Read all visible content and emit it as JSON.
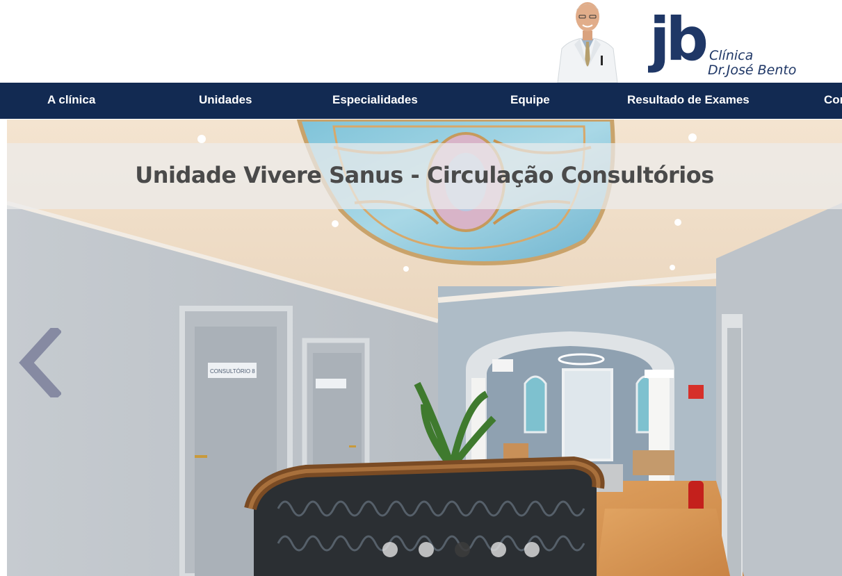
{
  "logo": {
    "mark": "jb",
    "line1": "Clínica",
    "line2": "Dr.José Bento"
  },
  "nav": {
    "items": [
      {
        "label": "A clínica"
      },
      {
        "label": "Unidades"
      },
      {
        "label": "Especialidades"
      },
      {
        "label": "Equipe"
      },
      {
        "label": "Resultado de Exames"
      },
      {
        "label": "Con"
      }
    ]
  },
  "slider": {
    "caption": "Unidade Vivere Sanus - Circulação Consultórios",
    "door_sign": "CONSULTÓRIO 8",
    "slide_count": 5,
    "active_slide": 3
  },
  "colors": {
    "nav_bg": "#122a52",
    "brand_blue": "#1f3766"
  },
  "icons": {
    "prev": "chevron-left-icon"
  }
}
